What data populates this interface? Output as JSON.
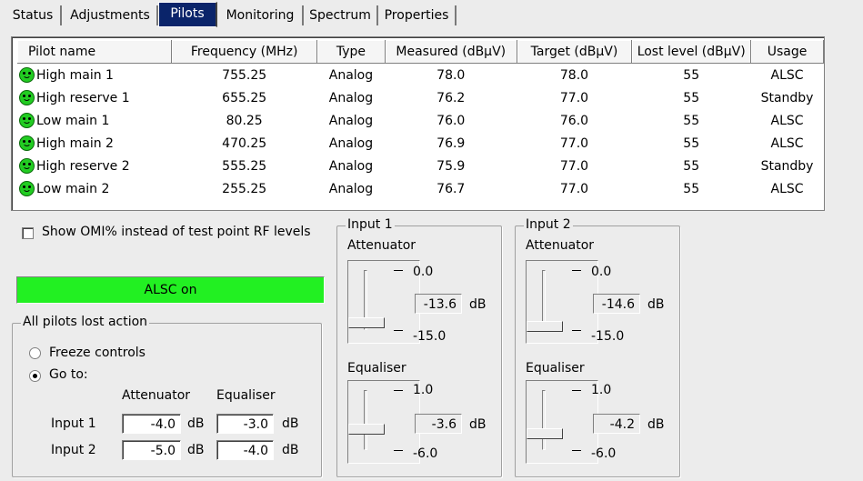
{
  "tabs": [
    {
      "label": "Status",
      "active": false
    },
    {
      "label": "Adjustments",
      "active": false
    },
    {
      "label": "Pilots",
      "active": true
    },
    {
      "label": "Monitoring",
      "active": false
    },
    {
      "label": "Spectrum",
      "active": false
    },
    {
      "label": "Properties",
      "active": false
    }
  ],
  "table": {
    "columns": [
      "Pilot name",
      "Frequency (MHz)",
      "Type",
      "Measured (dBµV)",
      "Target (dBµV)",
      "Lost level (dBµV)",
      "Usage"
    ],
    "rows": [
      {
        "name": "High main 1",
        "frequency": "755.25",
        "type": "Analog",
        "measured": "78.0",
        "target": "78.0",
        "lost": "55",
        "usage": "ALSC"
      },
      {
        "name": "High reserve 1",
        "frequency": "655.25",
        "type": "Analog",
        "measured": "76.2",
        "target": "77.0",
        "lost": "55",
        "usage": "Standby"
      },
      {
        "name": "Low main 1",
        "frequency": "80.25",
        "type": "Analog",
        "measured": "76.0",
        "target": "76.0",
        "lost": "55",
        "usage": "ALSC"
      },
      {
        "name": "High main 2",
        "frequency": "470.25",
        "type": "Analog",
        "measured": "76.9",
        "target": "77.0",
        "lost": "55",
        "usage": "ALSC"
      },
      {
        "name": "High reserve 2",
        "frequency": "555.25",
        "type": "Analog",
        "measured": "75.9",
        "target": "77.0",
        "lost": "55",
        "usage": "Standby"
      },
      {
        "name": "Low main 2",
        "frequency": "255.25",
        "type": "Analog",
        "measured": "76.7",
        "target": "77.0",
        "lost": "55",
        "usage": "ALSC"
      }
    ],
    "status_icon": "smiley-ok-icon",
    "status_color": "#22cc22"
  },
  "show_omi": {
    "label": "Show OMI% instead of test point RF levels",
    "checked": false
  },
  "alsc_status": {
    "text": "ALSC on",
    "color": "#22f022"
  },
  "lost_action": {
    "title": "All pilots lost action",
    "freeze_label": "Freeze controls",
    "goto_label": "Go to:",
    "selected": "goto",
    "col_attenuator": "Attenuator",
    "col_equaliser": "Equaliser",
    "unit": "dB",
    "rows": [
      {
        "label": "Input 1",
        "attenuator": "-4.0",
        "equaliser": "-3.0"
      },
      {
        "label": "Input 2",
        "attenuator": "-5.0",
        "equaliser": "-4.0"
      }
    ]
  },
  "inputs": [
    {
      "title": "Input 1",
      "attenuator": {
        "label": "Attenuator",
        "max": "0.0",
        "value": "-13.6",
        "min": "-15.0",
        "unit": "dB",
        "level": 0.093
      },
      "equaliser": {
        "label": "Equaliser",
        "max": "1.0",
        "value": "-3.6",
        "min": "-6.0",
        "unit": "dB",
        "level": 0.343
      }
    },
    {
      "title": "Input 2",
      "attenuator": {
        "label": "Attenuator",
        "max": "0.0",
        "value": "-14.6",
        "min": "-15.0",
        "unit": "dB",
        "level": 0.027
      },
      "equaliser": {
        "label": "Equaliser",
        "max": "1.0",
        "value": "-4.2",
        "min": "-6.0",
        "unit": "dB",
        "level": 0.257
      }
    }
  ]
}
